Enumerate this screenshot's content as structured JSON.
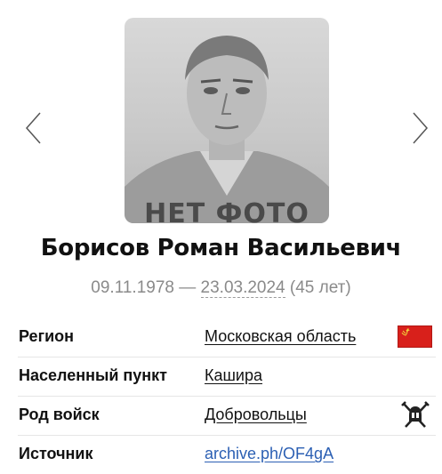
{
  "profile": {
    "photo_placeholder": "НЕТ ФОТО",
    "name": "Борисов Роман Васильевич",
    "birth_date": "09.11.1978",
    "date_separator": " — ",
    "death_date": "23.03.2024",
    "age": " (45 лет)"
  },
  "icons": {
    "prev": "chevron-left-icon",
    "next": "chevron-right-icon",
    "report": "flag-icon",
    "region_flag": "ussr-flag-icon",
    "troops": "crossed-swords-helmet-icon"
  },
  "details": {
    "region_label": "Регион",
    "region_value": "Московская область",
    "locality_label": "Населенный пункт",
    "locality_value": "Кашира",
    "troops_label": "Род войск",
    "troops_value": "Добровольцы",
    "source_label": "Источник",
    "source_value": "archive.ph/OF4gA"
  },
  "colors": {
    "accent_red": "#d8201b",
    "link_blue": "#2b5fb3",
    "muted_text": "#8a8a8a"
  }
}
